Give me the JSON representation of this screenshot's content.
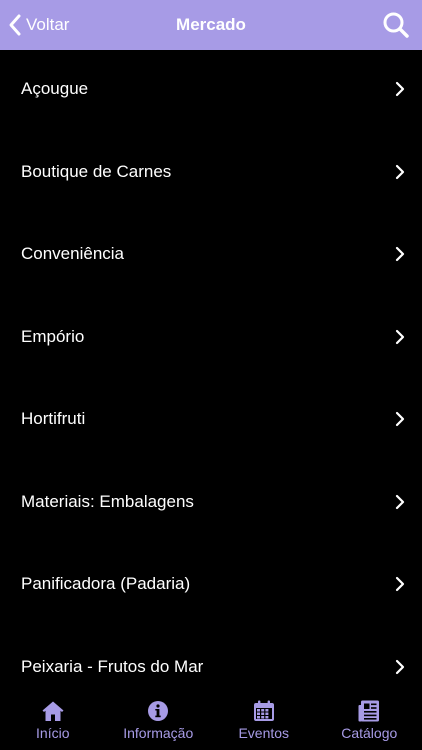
{
  "colors": {
    "accent": "#a79be6",
    "background": "#000000",
    "text": "#ffffff"
  },
  "navbar": {
    "back_label": "Voltar",
    "title": "Mercado",
    "back_icon": "chevron-left-icon",
    "search_icon": "search-icon"
  },
  "list": {
    "items": [
      {
        "label": "Açougue"
      },
      {
        "label": "Boutique de Carnes"
      },
      {
        "label": "Conveniência"
      },
      {
        "label": "Empório"
      },
      {
        "label": "Hortifruti"
      },
      {
        "label": "Materiais: Embalagens"
      },
      {
        "label": "Panificadora (Padaria)"
      },
      {
        "label": "Peixaria - Frutos do Mar"
      }
    ]
  },
  "tabbar": {
    "tabs": [
      {
        "label": "Início",
        "icon": "home-icon"
      },
      {
        "label": "Informação",
        "icon": "info-icon"
      },
      {
        "label": "Eventos",
        "icon": "calendar-icon"
      },
      {
        "label": "Catálogo",
        "icon": "catalog-icon"
      }
    ]
  }
}
